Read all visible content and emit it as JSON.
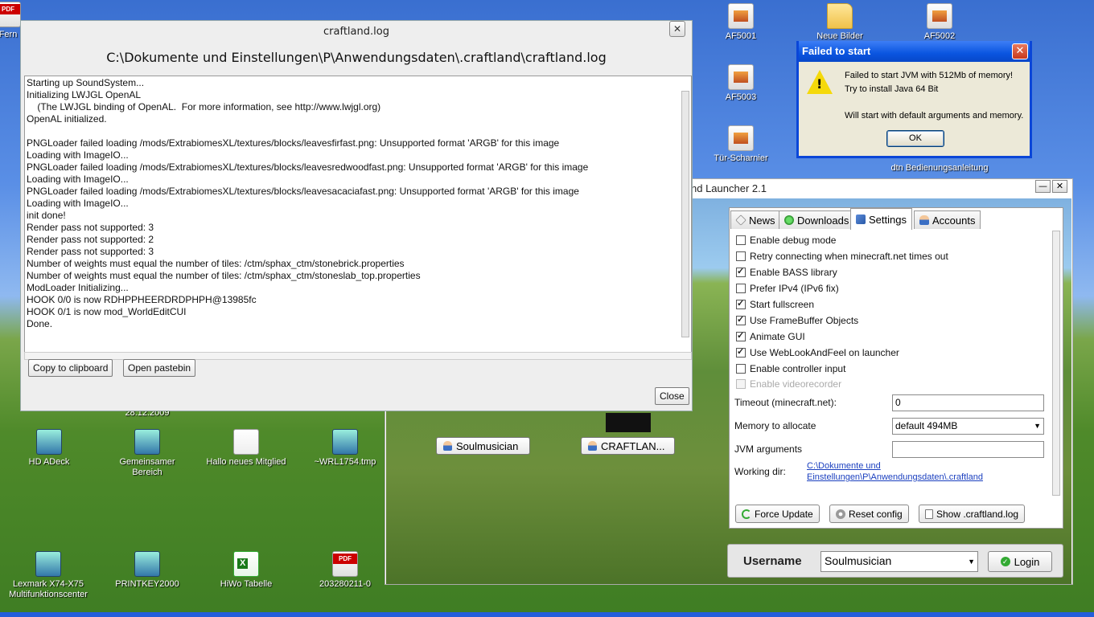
{
  "desktop": {
    "icons": [
      {
        "label": "Fern",
        "type": "pdf"
      },
      {
        "label": "AF5001",
        "type": "img"
      },
      {
        "label": "Neue Bilder",
        "type": "folder"
      },
      {
        "label": "AF5002",
        "type": "img"
      },
      {
        "label": "AF5003",
        "type": "img"
      },
      {
        "label": "Tür-Scharnier",
        "type": "img"
      },
      {
        "label": "dtn Bedienungsanleitung",
        "type": "img"
      },
      {
        "label": "28.12.2009",
        "type": "none"
      },
      {
        "label": "HD ADeck",
        "type": "exe"
      },
      {
        "label": "Gemeinsamer Bereich",
        "type": "exe"
      },
      {
        "label": "Hallo neues Mitglied",
        "type": "mail"
      },
      {
        "label": "~WRL1754.tmp",
        "type": "exe"
      },
      {
        "label": "Lexmark X74-X75 Multifunktionscenter",
        "type": "exe"
      },
      {
        "label": "PRINTKEY2000",
        "type": "exe"
      },
      {
        "label": "HiWo Tabelle",
        "type": "xls"
      },
      {
        "label": "203280211-0",
        "type": "pdf"
      }
    ]
  },
  "log_window": {
    "title": "craftland.log",
    "path": "C:\\Dokumente und Einstellungen\\P\\Anwendungsdaten\\.craftland\\craftland.log",
    "lines": [
      "Starting up SoundSystem...",
      "Initializing LWJGL OpenAL",
      "    (The LWJGL binding of OpenAL.  For more information, see http://www.lwjgl.org)",
      "OpenAL initialized.",
      "",
      "PNGLoader failed loading /mods/ExtrabiomesXL/textures/blocks/leavesfirfast.png: Unsupported format 'ARGB' for this image",
      "Loading with ImageIO...",
      "PNGLoader failed loading /mods/ExtrabiomesXL/textures/blocks/leavesredwoodfast.png: Unsupported format 'ARGB' for this image",
      "Loading with ImageIO...",
      "PNGLoader failed loading /mods/ExtrabiomesXL/textures/blocks/leavesacaciafast.png: Unsupported format 'ARGB' for this image",
      "Loading with ImageIO...",
      "init done!",
      "Render pass not supported: 3",
      "Render pass not supported: 2",
      "Render pass not supported: 3",
      "Number of weights must equal the number of tiles: /ctm/sphax_ctm/stonebrick.properties",
      "Number of weights must equal the number of tiles: /ctm/sphax_ctm/stoneslab_top.properties",
      "ModLoader Initializing...",
      "HOOK 0/0 is now RDHPPHEERDRDPHPH@13985fc",
      "HOOK 0/1 is now mod_WorldEditCUI",
      "Done."
    ],
    "copy_label": "Copy to clipboard",
    "pastebin_label": "Open pastebin",
    "close_label": "Close",
    "close_x": "✕"
  },
  "dialog": {
    "title": "Failed to start",
    "line1": "Failed to start JVM with 512Mb of memory!",
    "line2": "Try to install Java 64 Bit",
    "line3": "Will start with default arguments and memory.",
    "ok_label": "OK",
    "close_x": "✕"
  },
  "launcher": {
    "title": "nd Launcher 2.1",
    "min": "—",
    "close": "✕",
    "skins": [
      "Soulmusician",
      "CRAFTLAN..."
    ],
    "tabs": [
      {
        "label": "News",
        "active": false
      },
      {
        "label": "Downloads",
        "active": false
      },
      {
        "label": "Settings",
        "active": true
      },
      {
        "label": "Accounts",
        "active": false
      }
    ],
    "options": [
      {
        "label": "Enable debug mode",
        "checked": false,
        "enabled": true
      },
      {
        "label": "Retry connecting when minecraft.net times out",
        "checked": false,
        "enabled": true
      },
      {
        "label": "Enable BASS library",
        "checked": true,
        "enabled": true
      },
      {
        "label": "Prefer IPv4 (IPv6 fix)",
        "checked": false,
        "enabled": true
      },
      {
        "label": "Start fullscreen",
        "checked": true,
        "enabled": true
      },
      {
        "label": "Use FrameBuffer Objects",
        "checked": true,
        "enabled": true
      },
      {
        "label": "Animate GUI",
        "checked": true,
        "enabled": true
      },
      {
        "label": "Use WebLookAndFeel on launcher",
        "checked": true,
        "enabled": true
      },
      {
        "label": "Enable controller input",
        "checked": false,
        "enabled": true
      },
      {
        "label": "Enable videorecorder",
        "checked": false,
        "enabled": false
      }
    ],
    "timeout_label": "Timeout (minecraft.net):",
    "timeout_value": "0",
    "memory_label": "Memory to allocate",
    "memory_value": "default 494MB",
    "jvm_label": "JVM arguments",
    "jvm_value": "",
    "workdir_label": "Working dir:",
    "workdir_line1": "C:\\Dokumente und",
    "workdir_line2": "Einstellungen\\P\\Anwendungsdaten\\.craftland",
    "force_update": "Force Update",
    "reset_config": "Reset config",
    "show_log": "Show .craftland.log",
    "username_label": "Username",
    "username_value": "Soulmusician",
    "login_label": "Login",
    "dropdown_arrow": "▼"
  }
}
